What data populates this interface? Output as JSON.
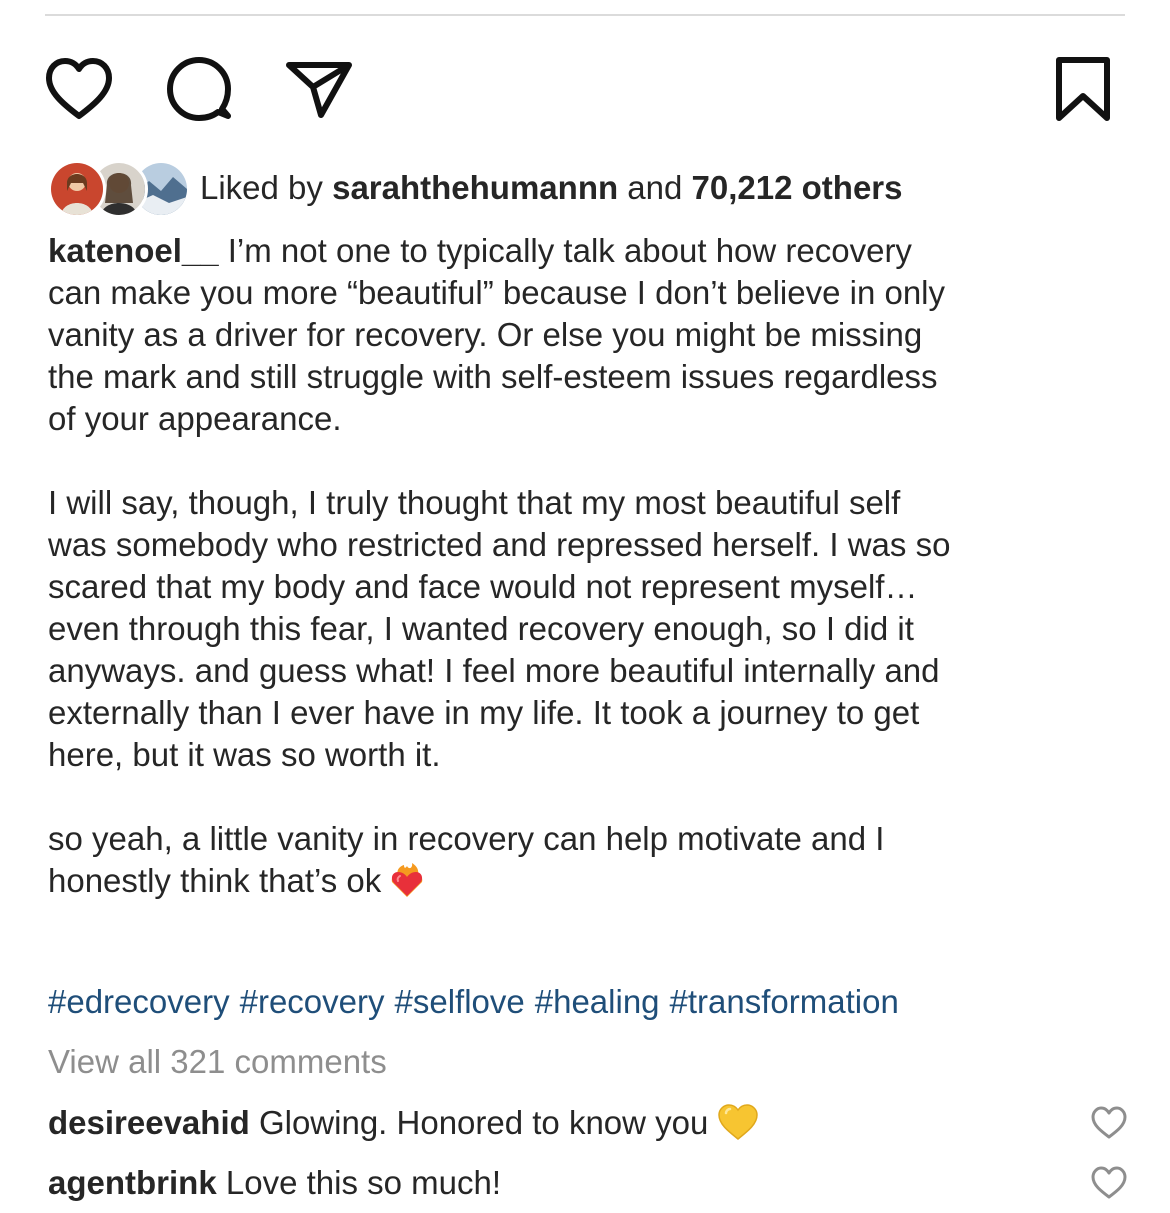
{
  "actions": {
    "like_icon": "heart-outline",
    "comment_icon": "speech-bubble",
    "share_icon": "paper-plane",
    "save_icon": "bookmark"
  },
  "likes": {
    "prefix": "Liked by ",
    "user": "sarahthehumannn",
    "middle": " and ",
    "count": "70,212 others"
  },
  "caption": {
    "username": "katenoel__",
    "text": " I’m not one to typically talk about how recovery\ncan make you more “beautiful” because I don’t believe in only\nvanity as a driver for recovery. Or else you might be missing\nthe mark and still struggle with self-esteem issues regardless\nof your appearance.\n\nI will say, though, I truly thought that my most beautiful self\nwas somebody who restricted and repressed herself. I was so\nscared that my body and face would not represent myself…\neven through this fear, I wanted recovery enough, so I did it\nanyways. and guess what! I feel more beautiful internally and\nexternally than I ever have in my life. It took a journey to get\nhere, but it was so worth it.\n\nso yeah, a little vanity in recovery can help motivate and I\nhonestly think that’s ok",
    "emoji": "heart-on-fire"
  },
  "hashtags": [
    "#edrecovery",
    "#recovery",
    "#selflove",
    "#healing",
    "#transformation"
  ],
  "view_all_comments": "View all 321 comments",
  "comments": [
    {
      "user": "desireevahid",
      "text": " Glowing. Honored to know you",
      "emoji": "yellow-heart"
    },
    {
      "user": "agentbrink",
      "text": " Love this so much!",
      "emoji": ""
    }
  ],
  "colors": {
    "text": "#262626",
    "hashtag": "#1f4e79",
    "muted": "#8e8e8e",
    "divider": "#dbdbdb"
  }
}
